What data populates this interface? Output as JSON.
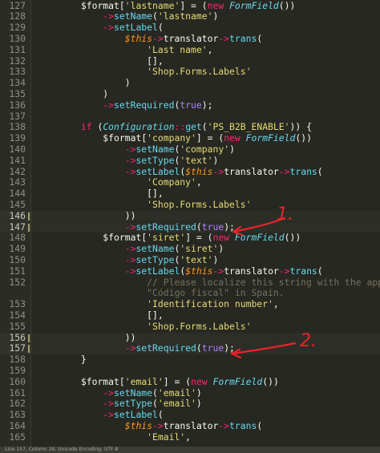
{
  "editor": {
    "lines": [
      {
        "n": "127",
        "t": [
          [
            "        ",
            "op"
          ],
          [
            "$format",
            "var"
          ],
          [
            "[",
            "op"
          ],
          [
            "'lastname'",
            "str"
          ],
          [
            "] = (",
            "op"
          ],
          [
            "new",
            "kw"
          ],
          [
            " ",
            "op"
          ],
          [
            "FormField",
            "cls"
          ],
          [
            "())",
            "op"
          ]
        ]
      },
      {
        "n": "128",
        "t": [
          [
            "            ->",
            "ar"
          ],
          [
            "setName",
            "fn"
          ],
          [
            "(",
            "op"
          ],
          [
            "'lastname'",
            "str"
          ],
          [
            ")",
            "op"
          ]
        ]
      },
      {
        "n": "129",
        "t": [
          [
            "            ->",
            "ar"
          ],
          [
            "setLabel",
            "fn"
          ],
          [
            "(",
            "op"
          ]
        ]
      },
      {
        "n": "130",
        "t": [
          [
            "                ",
            "op"
          ],
          [
            "$this",
            "th"
          ],
          [
            "->",
            "ar"
          ],
          [
            "translator",
            "op"
          ],
          [
            "->",
            "ar"
          ],
          [
            "trans",
            "fn"
          ],
          [
            "(",
            "op"
          ]
        ]
      },
      {
        "n": "131",
        "t": [
          [
            "                    ",
            "op"
          ],
          [
            "'Last name'",
            "str"
          ],
          [
            ",",
            "op"
          ]
        ]
      },
      {
        "n": "132",
        "t": [
          [
            "                    [],",
            "op"
          ]
        ]
      },
      {
        "n": "133",
        "t": [
          [
            "                    ",
            "op"
          ],
          [
            "'Shop.Forms.Labels'",
            "str"
          ]
        ]
      },
      {
        "n": "134",
        "t": [
          [
            "                )",
            "op"
          ]
        ]
      },
      {
        "n": "135",
        "t": [
          [
            "            )",
            "op"
          ]
        ]
      },
      {
        "n": "136",
        "t": [
          [
            "            ->",
            "ar"
          ],
          [
            "setRequired",
            "fn"
          ],
          [
            "(",
            "op"
          ],
          [
            "true",
            "bool"
          ],
          [
            ");",
            "op"
          ]
        ]
      },
      {
        "n": "137",
        "t": [
          [
            "",
            "op"
          ]
        ]
      },
      {
        "n": "138",
        "t": [
          [
            "        ",
            "op"
          ],
          [
            "if",
            "kw"
          ],
          [
            " (",
            "op"
          ],
          [
            "Configuration",
            "cls"
          ],
          [
            "::",
            "ar"
          ],
          [
            "get",
            "fn"
          ],
          [
            "(",
            "op"
          ],
          [
            "'PS_B2B_ENABLE'",
            "str"
          ],
          [
            ")) {",
            "op"
          ]
        ]
      },
      {
        "n": "139",
        "t": [
          [
            "            ",
            "op"
          ],
          [
            "$format",
            "var"
          ],
          [
            "[",
            "op"
          ],
          [
            "'company'",
            "str"
          ],
          [
            "] = (",
            "op"
          ],
          [
            "new",
            "kw"
          ],
          [
            " ",
            "op"
          ],
          [
            "FormField",
            "cls"
          ],
          [
            "())",
            "op"
          ]
        ]
      },
      {
        "n": "140",
        "t": [
          [
            "                ->",
            "ar"
          ],
          [
            "setName",
            "fn"
          ],
          [
            "(",
            "op"
          ],
          [
            "'company'",
            "str"
          ],
          [
            ")",
            "op"
          ]
        ]
      },
      {
        "n": "141",
        "t": [
          [
            "                ->",
            "ar"
          ],
          [
            "setType",
            "fn"
          ],
          [
            "(",
            "op"
          ],
          [
            "'text'",
            "str"
          ],
          [
            ")",
            "op"
          ]
        ]
      },
      {
        "n": "142",
        "t": [
          [
            "                ->",
            "ar"
          ],
          [
            "setLabel",
            "fn"
          ],
          [
            "(",
            "op"
          ],
          [
            "$this",
            "th"
          ],
          [
            "->",
            "ar"
          ],
          [
            "translator",
            "op"
          ],
          [
            "->",
            "ar"
          ],
          [
            "trans",
            "fn"
          ],
          [
            "(",
            "op"
          ]
        ]
      },
      {
        "n": "143",
        "t": [
          [
            "                    ",
            "op"
          ],
          [
            "'Company'",
            "str"
          ],
          [
            ",",
            "op"
          ]
        ]
      },
      {
        "n": "144",
        "t": [
          [
            "                    [],",
            "op"
          ]
        ]
      },
      {
        "n": "145",
        "t": [
          [
            "                    ",
            "op"
          ],
          [
            "'Shop.Forms.Labels'",
            "str"
          ]
        ]
      },
      {
        "n": "146",
        "hl": true,
        "t": [
          [
            "                ))",
            "op"
          ]
        ]
      },
      {
        "n": "147",
        "hl": true,
        "t": [
          [
            "                ->",
            "ar"
          ],
          [
            "setRequired",
            "fn"
          ],
          [
            "(",
            "op"
          ],
          [
            "true",
            "bool"
          ],
          [
            ");",
            "op"
          ]
        ]
      },
      {
        "n": "148",
        "t": [
          [
            "            ",
            "op"
          ],
          [
            "$format",
            "var"
          ],
          [
            "[",
            "op"
          ],
          [
            "'siret'",
            "str"
          ],
          [
            "] = (",
            "op"
          ],
          [
            "new",
            "kw"
          ],
          [
            " ",
            "op"
          ],
          [
            "FormField",
            "cls"
          ],
          [
            "())",
            "op"
          ]
        ]
      },
      {
        "n": "149",
        "t": [
          [
            "                ->",
            "ar"
          ],
          [
            "setName",
            "fn"
          ],
          [
            "(",
            "op"
          ],
          [
            "'siret'",
            "str"
          ],
          [
            ")",
            "op"
          ]
        ]
      },
      {
        "n": "150",
        "t": [
          [
            "                ->",
            "ar"
          ],
          [
            "setType",
            "fn"
          ],
          [
            "(",
            "op"
          ],
          [
            "'text'",
            "str"
          ],
          [
            ")",
            "op"
          ]
        ]
      },
      {
        "n": "151",
        "t": [
          [
            "                ->",
            "ar"
          ],
          [
            "setLabel",
            "fn"
          ],
          [
            "(",
            "op"
          ],
          [
            "$this",
            "th"
          ],
          [
            "->",
            "ar"
          ],
          [
            "translator",
            "op"
          ],
          [
            "->",
            "ar"
          ],
          [
            "trans",
            "fn"
          ],
          [
            "(",
            "op"
          ]
        ]
      },
      {
        "n": "152",
        "t": [
          [
            "                    ",
            "op"
          ],
          [
            "// Please localize this string with the appli",
            "cm"
          ]
        ]
      },
      {
        "n": "",
        "t": [
          [
            "                    ",
            "op"
          ],
          [
            "\"Código fiscal\" in Spain.",
            "cm"
          ]
        ]
      },
      {
        "n": "153",
        "t": [
          [
            "                    ",
            "op"
          ],
          [
            "'Identification number'",
            "str"
          ],
          [
            ",",
            "op"
          ]
        ]
      },
      {
        "n": "154",
        "t": [
          [
            "                    [],",
            "op"
          ]
        ]
      },
      {
        "n": "155",
        "t": [
          [
            "                    ",
            "op"
          ],
          [
            "'Shop.Forms.Labels'",
            "str"
          ]
        ]
      },
      {
        "n": "156",
        "hl": true,
        "t": [
          [
            "                ))",
            "op"
          ]
        ]
      },
      {
        "n": "157",
        "hl": true,
        "t": [
          [
            "                ->",
            "ar"
          ],
          [
            "setRequired",
            "fn"
          ],
          [
            "(",
            "op"
          ],
          [
            "true",
            "bool"
          ],
          [
            ");",
            "op"
          ]
        ]
      },
      {
        "n": "158",
        "t": [
          [
            "        }",
            "op"
          ]
        ]
      },
      {
        "n": "159",
        "t": [
          [
            "",
            "op"
          ]
        ]
      },
      {
        "n": "160",
        "t": [
          [
            "        ",
            "op"
          ],
          [
            "$format",
            "var"
          ],
          [
            "[",
            "op"
          ],
          [
            "'email'",
            "str"
          ],
          [
            "] = (",
            "op"
          ],
          [
            "new",
            "kw"
          ],
          [
            " ",
            "op"
          ],
          [
            "FormField",
            "cls"
          ],
          [
            "())",
            "op"
          ]
        ]
      },
      {
        "n": "161",
        "t": [
          [
            "            ->",
            "ar"
          ],
          [
            "setName",
            "fn"
          ],
          [
            "(",
            "op"
          ],
          [
            "'email'",
            "str"
          ],
          [
            ")",
            "op"
          ]
        ]
      },
      {
        "n": "162",
        "t": [
          [
            "            ->",
            "ar"
          ],
          [
            "setType",
            "fn"
          ],
          [
            "(",
            "op"
          ],
          [
            "'email'",
            "str"
          ],
          [
            ")",
            "op"
          ]
        ]
      },
      {
        "n": "163",
        "t": [
          [
            "            ->",
            "ar"
          ],
          [
            "setLabel",
            "fn"
          ],
          [
            "(",
            "op"
          ]
        ]
      },
      {
        "n": "164",
        "t": [
          [
            "                ",
            "op"
          ],
          [
            "$this",
            "th"
          ],
          [
            "->",
            "ar"
          ],
          [
            "translator",
            "op"
          ],
          [
            "->",
            "ar"
          ],
          [
            "trans",
            "fn"
          ],
          [
            "(",
            "op"
          ]
        ]
      },
      {
        "n": "165",
        "t": [
          [
            "                    ",
            "op"
          ],
          [
            "'Email'",
            "str"
          ],
          [
            ",",
            "op"
          ]
        ]
      }
    ]
  },
  "annotations": {
    "mark_1": "1.",
    "mark_2": "2.",
    "color": "#e8242a"
  },
  "status": {
    "text": "Line 157, Column 26; Unicode Encoding: UTF-8"
  },
  "theme": {
    "background": "#272822",
    "string": "#e6db74",
    "keyword": "#f92672",
    "function": "#66d9ef",
    "this": "#fd971f",
    "boolean": "#ae81ff"
  }
}
